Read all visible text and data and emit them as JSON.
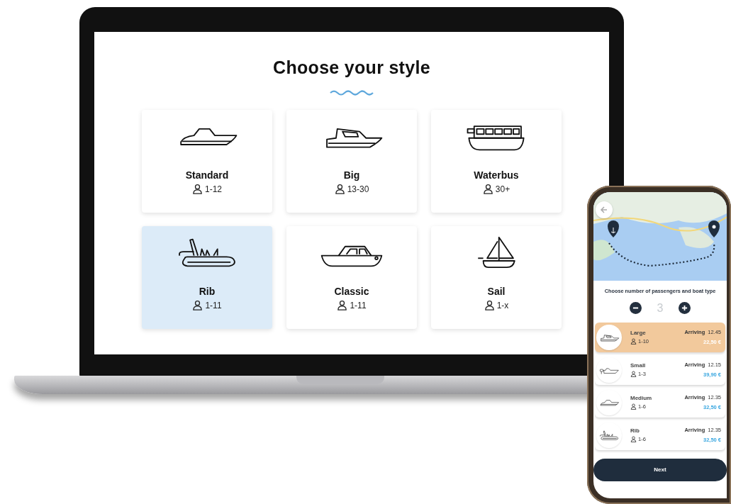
{
  "laptop": {
    "title": "Choose your style",
    "styles": [
      {
        "kind": "standard",
        "name": "Standard",
        "capacity": "1-12",
        "selected": false
      },
      {
        "kind": "big",
        "name": "Big",
        "capacity": "13-30",
        "selected": false
      },
      {
        "kind": "waterbus",
        "name": "Waterbus",
        "capacity": "30+",
        "selected": false
      },
      {
        "kind": "rib",
        "name": "Rib",
        "capacity": "1-11",
        "selected": true
      },
      {
        "kind": "classic",
        "name": "Classic",
        "capacity": "1-11",
        "selected": false
      },
      {
        "kind": "sail",
        "name": "Sail",
        "capacity": "1-x",
        "selected": false
      }
    ]
  },
  "phone": {
    "prompt": "Choose number of passengers and boat type",
    "passengers": "3",
    "options": [
      {
        "kind": "big",
        "name": "Large",
        "capacity": "1-10",
        "arriving_label": "Arriving",
        "time": "12.45",
        "price": "22,50 €",
        "selected": true
      },
      {
        "kind": "small",
        "name": "Small",
        "capacity": "1-3",
        "arriving_label": "Arriving",
        "time": "12.15",
        "price": "39,90 €",
        "selected": false
      },
      {
        "kind": "standard",
        "name": "Medium",
        "capacity": "1-6",
        "arriving_label": "Arriving",
        "time": "12.35",
        "price": "32,50 €",
        "selected": false
      },
      {
        "kind": "rib",
        "name": "Rib",
        "capacity": "1-6",
        "arriving_label": "Arriving",
        "time": "12.35",
        "price": "32,50 €",
        "selected": false
      }
    ],
    "next_button": "Next"
  }
}
